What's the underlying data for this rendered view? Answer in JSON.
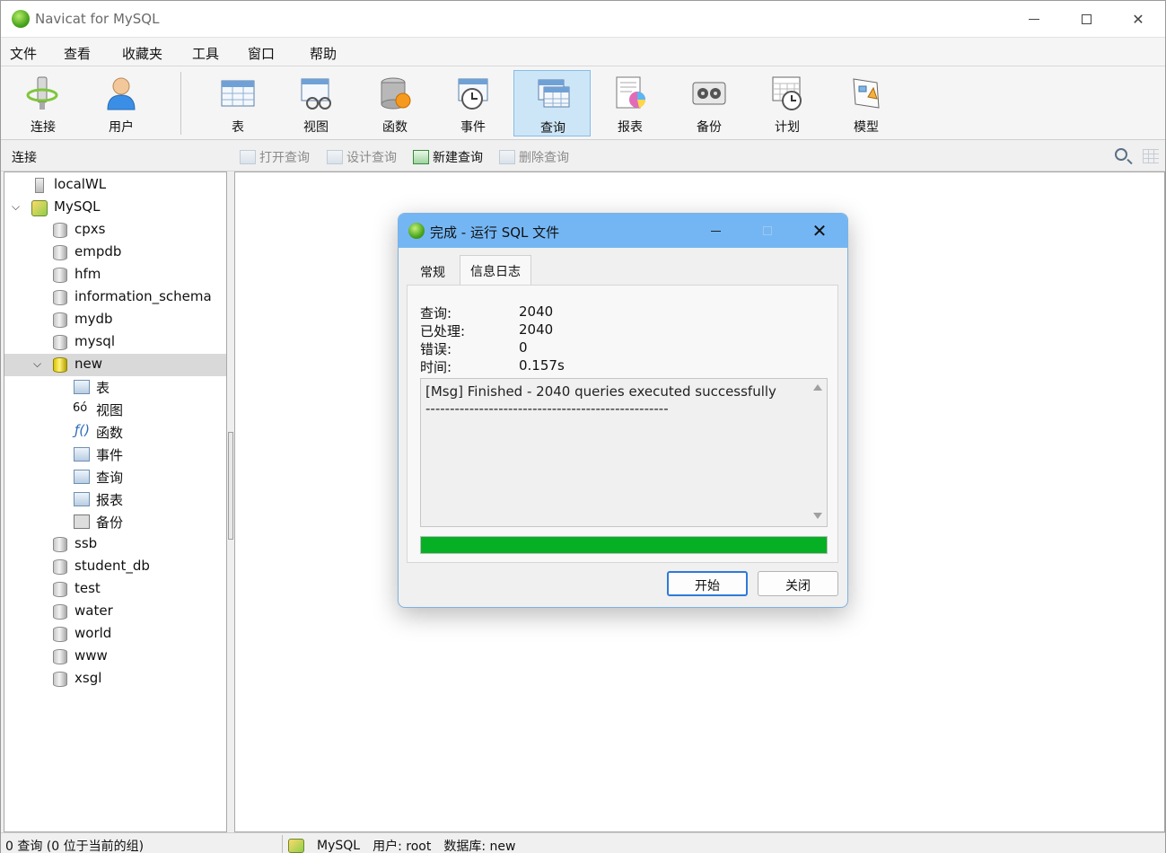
{
  "window": {
    "title": "Navicat for MySQL"
  },
  "menu": [
    "文件",
    "查看",
    "收藏夹",
    "工具",
    "窗口",
    "帮助"
  ],
  "toolbar": [
    {
      "label": "连接",
      "icon": "connection-icon"
    },
    {
      "label": "用户",
      "icon": "user-icon"
    },
    {
      "label": "表",
      "icon": "table-icon"
    },
    {
      "label": "视图",
      "icon": "view-icon"
    },
    {
      "label": "函数",
      "icon": "function-icon"
    },
    {
      "label": "事件",
      "icon": "event-icon"
    },
    {
      "label": "查询",
      "icon": "query-icon",
      "active": true
    },
    {
      "label": "报表",
      "icon": "report-icon"
    },
    {
      "label": "备份",
      "icon": "backup-icon"
    },
    {
      "label": "计划",
      "icon": "schedule-icon"
    },
    {
      "label": "模型",
      "icon": "model-icon"
    }
  ],
  "subbar": {
    "connection_label": "连接",
    "open_query": "打开查询",
    "design_query": "设计查询",
    "new_query": "新建查询",
    "delete_query": "删除查询"
  },
  "tree": {
    "local": "localWL",
    "mysql": "MySQL",
    "databases_before": [
      "cpxs",
      "empdb",
      "hfm",
      "information_schema",
      "mydb",
      "mysql"
    ],
    "open_db": "new",
    "objects": [
      "表",
      "视图",
      "函数",
      "事件",
      "查询",
      "报表",
      "备份"
    ],
    "databases_after": [
      "ssb",
      "student_db",
      "test",
      "water",
      "world",
      "www",
      "xsgl"
    ]
  },
  "status": {
    "left": "0 查询 (0 位于当前的组)",
    "connection": "MySQL",
    "user": "用户: root",
    "database": "数据库: new"
  },
  "dialog": {
    "title": "完成 - 运行 SQL 文件",
    "tabs": {
      "general": "常规",
      "log": "信息日志"
    },
    "stats": {
      "queries_label": "查询:",
      "queries_value": "2040",
      "processed_label": "已处理:",
      "processed_value": "2040",
      "errors_label": "错误:",
      "errors_value": "0",
      "time_label": "时间:",
      "time_value": "0.157s"
    },
    "log": [
      "[Msg] Finished - 2040 queries executed successfully",
      "--------------------------------------------------"
    ],
    "progress": 1.0,
    "progress_color": "#06b025",
    "buttons": {
      "start": "开始",
      "close": "关闭"
    }
  }
}
